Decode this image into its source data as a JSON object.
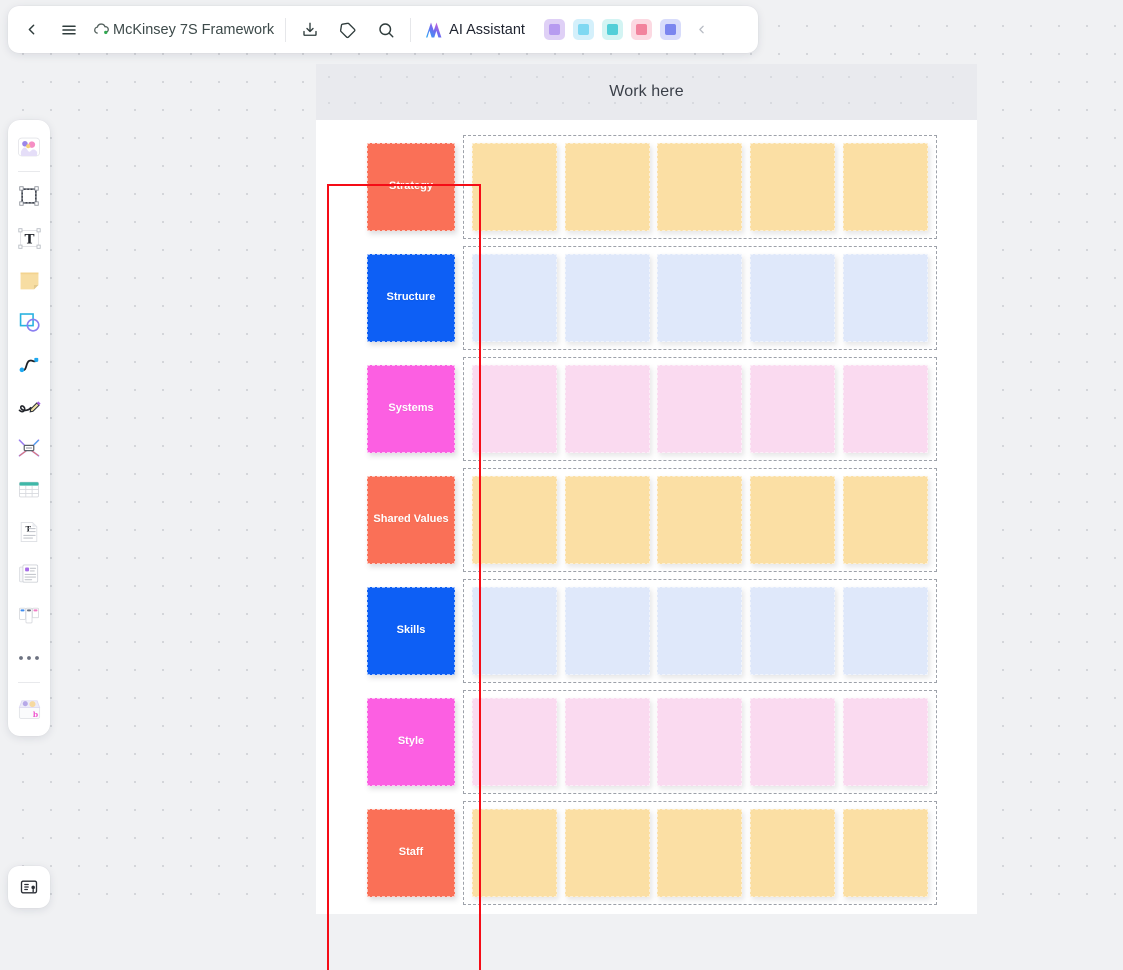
{
  "app": {
    "document_title": "McKinsey 7S Framework",
    "sync_status_icon": "cloud-synced-icon",
    "back_icon": "back-chevron-icon",
    "menu_icon": "hamburger-menu-icon",
    "download_icon": "download-icon",
    "tag_icon": "tag-icon",
    "search_icon": "search-icon",
    "collapse_icon": "collapse-chevron-icon"
  },
  "ai_assistant": {
    "label": "AI Assistant",
    "icon": "ai-sparkle-icon"
  },
  "plugins": [
    {
      "name": "image-plugin",
      "color1": "#dfd0f6",
      "color2": "#b79bf0"
    },
    {
      "name": "presentation-plugin",
      "color1": "#d4f0fb",
      "color2": "#7fd8f2"
    },
    {
      "name": "import-plugin",
      "color1": "#d3f4f3",
      "color2": "#52cfd8"
    },
    {
      "name": "mindmap-plugin",
      "color1": "#fcd9e2",
      "color2": "#f2839d"
    },
    {
      "name": "comment-plugin",
      "color1": "#d8dcfb",
      "color2": "#7b86ef"
    }
  ],
  "tool_rail": [
    {
      "name": "tool-templates",
      "label": "Templates"
    },
    {
      "name": "tool-frame",
      "label": "Frame"
    },
    {
      "name": "tool-text",
      "label": "Text"
    },
    {
      "name": "tool-sticky-note",
      "label": "Sticky note"
    },
    {
      "name": "tool-shapes",
      "label": "Shapes"
    },
    {
      "name": "tool-connector",
      "label": "Connector line"
    },
    {
      "name": "tool-pen",
      "label": "Pen"
    },
    {
      "name": "tool-mindmap",
      "label": "Mind map"
    },
    {
      "name": "tool-table",
      "label": "Table"
    },
    {
      "name": "tool-document",
      "label": "Document"
    },
    {
      "name": "tool-card",
      "label": "Card"
    },
    {
      "name": "tool-kanban",
      "label": "Kanban"
    },
    {
      "name": "tool-more",
      "label": "More"
    },
    {
      "name": "tool-upload",
      "label": "Upload"
    }
  ],
  "frames_button": {
    "name": "frames-panel-button",
    "icon": "frames-icon"
  },
  "board": {
    "title": "Work here",
    "selection_color": "#f50c16",
    "rows": [
      {
        "label": "Strategy",
        "label_color": "#fa7057",
        "note_color": "#fbdfa4",
        "notes": 5
      },
      {
        "label": "Structure",
        "label_color": "#0d5ff5",
        "note_color": "#dfe8fa",
        "notes": 5
      },
      {
        "label": "Systems",
        "label_color": "#fc5fe2",
        "note_color": "#fadaf0",
        "notes": 5
      },
      {
        "label": "Shared Values",
        "label_color": "#fa7057",
        "note_color": "#fbdfa4",
        "notes": 5
      },
      {
        "label": "Skills",
        "label_color": "#0d5ff5",
        "note_color": "#dfe8fa",
        "notes": 5
      },
      {
        "label": "Style",
        "label_color": "#fc5fe2",
        "note_color": "#fadaf0",
        "notes": 5
      },
      {
        "label": "Staff",
        "label_color": "#fa7057",
        "note_color": "#fbdfa4",
        "notes": 5
      }
    ]
  }
}
